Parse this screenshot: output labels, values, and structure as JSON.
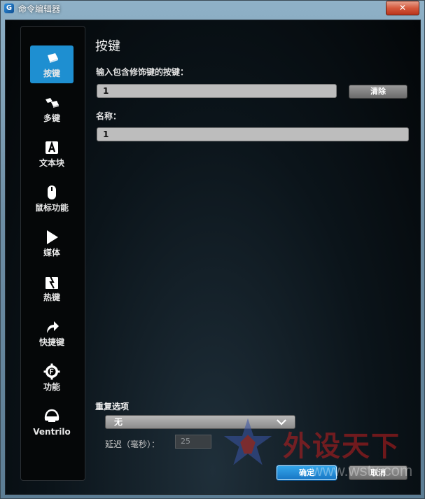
{
  "window": {
    "title": "命令编辑器",
    "app_icon_glyph": "G",
    "close_glyph": "✕"
  },
  "sidebar": {
    "items": [
      {
        "label": "按键",
        "icon": "key-icon",
        "active": true
      },
      {
        "label": "多键",
        "icon": "multi-key-icon",
        "active": false
      },
      {
        "label": "文本块",
        "icon": "text-block-icon",
        "active": false
      },
      {
        "label": "鼠标功能",
        "icon": "mouse-icon",
        "active": false
      },
      {
        "label": "媒体",
        "icon": "play-icon",
        "active": false
      },
      {
        "label": "热键",
        "icon": "hotkey-icon",
        "active": false
      },
      {
        "label": "快捷键",
        "icon": "shortcut-arrow-icon",
        "active": false
      },
      {
        "label": "功能",
        "icon": "function-gear-icon",
        "active": false
      },
      {
        "label": "Ventrilo",
        "icon": "headset-icon",
        "active": false
      }
    ]
  },
  "main": {
    "section_title": "按键",
    "key_input_label": "输入包含修饰键的按键：",
    "key_input_value": "1",
    "clear_button": "清除",
    "name_label": "名称：",
    "name_value": "1",
    "repeat_label": "重复选项",
    "repeat_value": "无",
    "delay_label": "延迟（毫秒）：",
    "delay_value": "25"
  },
  "footer": {
    "ok_button": "确定",
    "cancel_button": "取消"
  },
  "watermark": {
    "text": "外设天下",
    "url": "www.wstx.com"
  },
  "colors": {
    "accent": "#1e8fd1",
    "background": "#0b141a",
    "watermark": "#d21e1e"
  }
}
